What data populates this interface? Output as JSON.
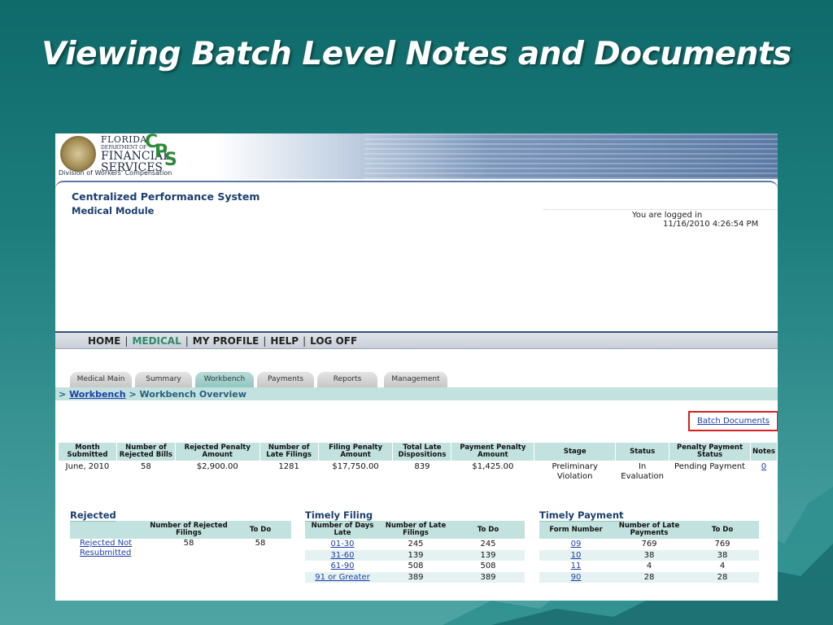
{
  "slide_title": "Viewing Batch Level Notes and Documents",
  "logo": {
    "line1": "FLORIDA",
    "line2": "DEPARTMENT OF",
    "line3": "FINANCIAL",
    "line4": "SERVICES",
    "cps_c": "C",
    "cps_p": "P",
    "cps_s": "S",
    "division": "Division of Workers' Compensation"
  },
  "app": {
    "title": "Centralized Performance System",
    "subtitle": "Medical Module",
    "logged_in": "You are logged in",
    "timestamp": "11/16/2010 4:26:54 PM"
  },
  "nav": {
    "home": "HOME",
    "medical": "MEDICAL",
    "my_profile": "MY PROFILE",
    "help": "HELP",
    "log_off": "LOG OFF",
    "sep": "|"
  },
  "tabs": [
    "Medical Main",
    "Summary",
    "Workbench",
    "Payments",
    "Reports",
    "Management"
  ],
  "breadcrumb": {
    "prefix": ">",
    "link": "Workbench",
    "separator": ">",
    "current": "Workbench Overview"
  },
  "batch_documents": "Batch Documents",
  "summary": {
    "headers": [
      "Month Submitted",
      "Number of Rejected Bills",
      "Rejected Penalty Amount",
      "Number of Late Filings",
      "Filing Penalty Amount",
      "Total Late Dispositions",
      "Payment Penalty Amount",
      "Stage",
      "Status",
      "Penalty Payment Status",
      "Notes"
    ],
    "row": [
      "June, 2010",
      "58",
      "$2,900.00",
      "1281",
      "$17,750.00",
      "839",
      "$1,425.00",
      "Preliminary Violation",
      "In Evaluation",
      "Pending Payment",
      "0"
    ]
  },
  "rejected": {
    "title": "Rejected",
    "headers": [
      "",
      "Number of Rejected Filings",
      "To Do"
    ],
    "rows": [
      [
        "Rejected Not Resubmitted",
        "58",
        "58"
      ]
    ]
  },
  "timely_filing": {
    "title": "Timely Filing",
    "headers": [
      "Number of Days Late",
      "Number of Late Filings",
      "To Do"
    ],
    "rows": [
      [
        "01-30",
        "245",
        "245"
      ],
      [
        "31-60",
        "139",
        "139"
      ],
      [
        "61-90",
        "508",
        "508"
      ],
      [
        "91 or Greater",
        "389",
        "389"
      ]
    ]
  },
  "timely_payment": {
    "title": "Timely Payment",
    "headers": [
      "Form Number",
      "Number of Late Payments",
      "To Do"
    ],
    "rows": [
      [
        "09",
        "769",
        "769"
      ],
      [
        "10",
        "38",
        "38"
      ],
      [
        "11",
        "4",
        "4"
      ],
      [
        "90",
        "28",
        "28"
      ]
    ]
  },
  "colors": {
    "slide_bg": "#1c7c7c",
    "header_blue": "#1a3e6e",
    "table_header": "#c2e2df",
    "link": "#1c3ea8",
    "highlight_box": "#d42020",
    "active_nav": "#2f8a6a"
  }
}
